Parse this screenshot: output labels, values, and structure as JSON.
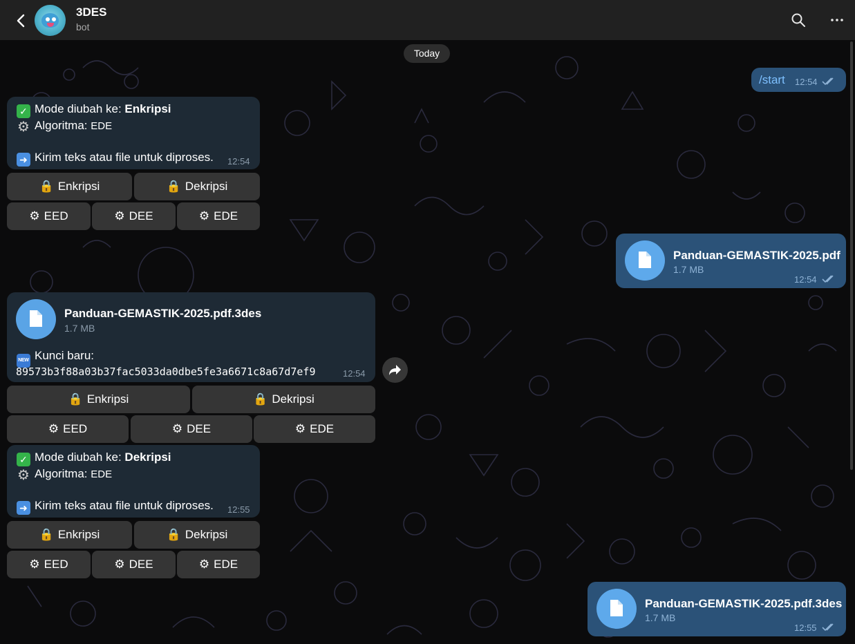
{
  "header": {
    "title": "3DES",
    "subtitle": "bot"
  },
  "chat": {
    "date_label": "Today",
    "messages": [
      {
        "direction": "out",
        "text": "/start",
        "time": "12:54"
      },
      {
        "direction": "in",
        "mode_prefix": "Mode diubah ke: ",
        "mode_value": "Enkripsi",
        "algo_prefix": "Algoritma: ",
        "algo_value": "EDE",
        "instruction": "Kirim teks atau file untuk diproses.",
        "time": "12:54",
        "buttons_row1": [
          "Enkripsi",
          "Dekripsi"
        ],
        "buttons_row2": [
          "EED",
          "DEE",
          "EDE"
        ]
      },
      {
        "direction": "out",
        "file_name": "Panduan-GEMASTIK-2025.pdf",
        "file_size": "1.7 MB",
        "time": "12:54"
      },
      {
        "direction": "in",
        "file_name": "Panduan-GEMASTIK-2025.pdf.3des",
        "file_size": "1.7 MB",
        "key_label": "Kunci baru:",
        "key_value": "89573b3f88a03b37fac5033da0dbe5fe3a6671c8a67d7ef9",
        "time": "12:54",
        "buttons_row1": [
          "Enkripsi",
          "Dekripsi"
        ],
        "buttons_row2": [
          "EED",
          "DEE",
          "EDE"
        ]
      },
      {
        "direction": "in",
        "mode_prefix": "Mode diubah ke: ",
        "mode_value": "Dekripsi",
        "algo_prefix": "Algoritma: ",
        "algo_value": "EDE",
        "instruction": "Kirim teks atau file untuk diproses.",
        "time": "12:55",
        "buttons_row1": [
          "Enkripsi",
          "Dekripsi"
        ],
        "buttons_row2": [
          "EED",
          "DEE",
          "EDE"
        ]
      },
      {
        "direction": "out",
        "file_name": "Panduan-GEMASTIK-2025.pdf.3des",
        "file_size": "1.7 MB",
        "time": "12:55"
      }
    ]
  },
  "icons": {
    "back": "back-arrow-icon",
    "search": "search-icon",
    "more": "more-options-icon",
    "file": "document-icon",
    "share": "forward-icon",
    "lock": "lock-icon",
    "gear": "gear-icon",
    "check": "check-emoji",
    "arrow": "right-arrow-emoji",
    "new": "new-badge-emoji"
  },
  "colors": {
    "header_bg": "#212121",
    "incoming_bubble": "#1e2a35",
    "outgoing_bubble": "#2b5278",
    "accent": "#5aa4e6",
    "keyboard_button": "#3a3a3a"
  }
}
